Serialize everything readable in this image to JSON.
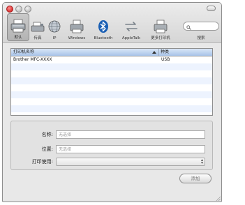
{
  "window": {
    "title": "",
    "traffic_lights": [
      "close",
      "minimize",
      "zoom"
    ]
  },
  "toolbar": {
    "items": [
      {
        "label": "默认",
        "icon": "default-printer-icon",
        "selected": true
      },
      {
        "label": "传真",
        "icon": "fax-icon",
        "selected": false
      },
      {
        "label": "IP",
        "icon": "ip-globe-icon",
        "selected": false
      },
      {
        "label": "Windows",
        "icon": "windows-printer-icon",
        "selected": false
      },
      {
        "label": "Bluetooth",
        "icon": "bluetooth-icon",
        "selected": false
      },
      {
        "label": "AppleTalk",
        "icon": "appletalk-icon",
        "selected": false
      },
      {
        "label": "更多打印机",
        "icon": "more-printers-icon",
        "selected": false
      },
      {
        "label": "搜索",
        "icon": "search-icon",
        "selected": false
      }
    ]
  },
  "printer_list": {
    "columns": [
      "打印机名称",
      "种类"
    ],
    "rows": [
      {
        "name": "Brother MFC-XXXX",
        "kind": "USB"
      }
    ]
  },
  "form": {
    "name_label": "名称:",
    "name_placeholder": "无选择",
    "location_label": "位置:",
    "location_placeholder": "无选择",
    "print_using_label": "打印使用:",
    "print_using_value": ""
  },
  "actions": {
    "add_label": "添加"
  },
  "colors": {
    "header_blue": "#a8c3e8",
    "row_alt": "#edf3fe",
    "bluetooth": "#1a5fb4"
  }
}
